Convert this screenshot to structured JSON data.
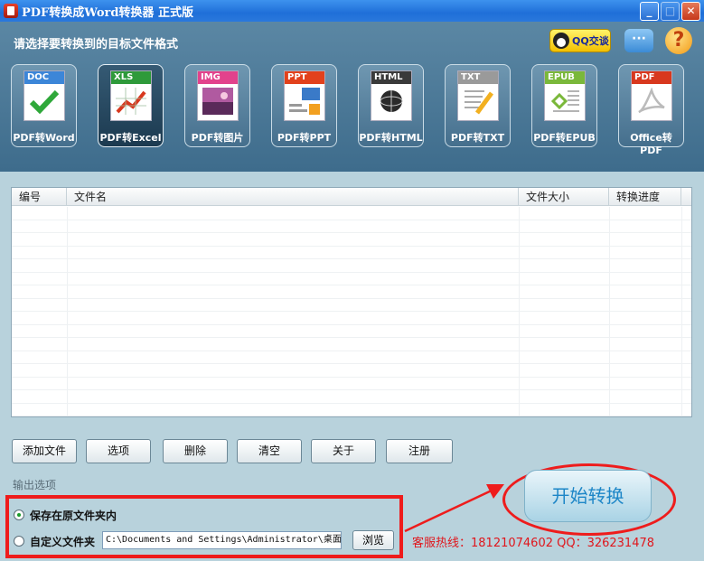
{
  "window": {
    "title": "PDF转换成Word转换器 正式版",
    "minimize": "_",
    "maximize": "□",
    "close": "✕"
  },
  "header": {
    "prompt": "请选择要转换到的目标文件格式",
    "qq_label": "QQ交谈",
    "chat_label": "···",
    "help_label": "?"
  },
  "formats": [
    {
      "band": "DOC",
      "label": "PDF转Word",
      "band_color": "#3c86d8"
    },
    {
      "band": "XLS",
      "label": "PDF转Excel",
      "band_color": "#2e9a3a"
    },
    {
      "band": "IMG",
      "label": "PDF转图片",
      "band_color": "#e2428c"
    },
    {
      "band": "PPT",
      "label": "PDF转PPT",
      "band_color": "#e2411c"
    },
    {
      "band": "HTML",
      "label": "PDF转HTML",
      "band_color": "#3a3a3a"
    },
    {
      "band": "TXT",
      "label": "PDF转TXT",
      "band_color": "#9a9a9a"
    },
    {
      "band": "EPUB",
      "label": "PDF转EPUB",
      "band_color": "#7ab83a"
    },
    {
      "band": "PDF",
      "label": "Office转PDF",
      "band_color": "#d8381e"
    }
  ],
  "table": {
    "columns": [
      "编号",
      "文件名",
      "文件大小",
      "转换进度"
    ],
    "rows": []
  },
  "buttons": {
    "add_file": "添加文件",
    "options": "选项",
    "delete": "删除",
    "clear": "清空",
    "about": "关于",
    "register": "注册"
  },
  "output": {
    "section_label": "输出选项",
    "save_original": "保存在原文件夹内",
    "custom_folder": "自定义文件夹",
    "path": "C:\\Documents and Settings\\Administrator\\桌面",
    "browse": "浏览"
  },
  "start_label": "开始转换",
  "hotline": "客服热线：18121074602 QQ：326231478"
}
